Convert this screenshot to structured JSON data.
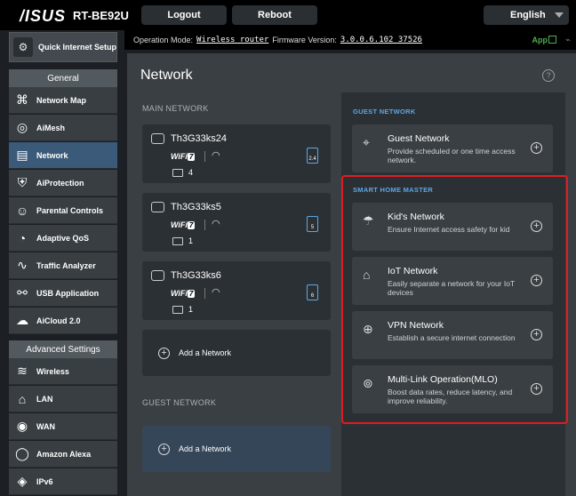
{
  "header": {
    "brand": "/ISUS",
    "model": "RT-BE92U",
    "logout_label": "Logout",
    "reboot_label": "Reboot",
    "language": "English"
  },
  "status": {
    "mode_label": "Operation Mode:",
    "mode_value": "Wireless router",
    "firmware_label": "Firmware Version:",
    "firmware_value": "3.0.0.6.102_37526",
    "app_label": "App"
  },
  "sidebar": {
    "quick_setup": "Quick Internet Setup",
    "general_header": "General",
    "general_items": [
      {
        "label": "Network Map",
        "icon": "network-map-icon"
      },
      {
        "label": "AiMesh",
        "icon": "aimesh-icon"
      },
      {
        "label": "Network",
        "icon": "network-icon"
      },
      {
        "label": "AiProtection",
        "icon": "aiprotection-icon"
      },
      {
        "label": "Parental Controls",
        "icon": "parental-icon"
      },
      {
        "label": "Adaptive QoS",
        "icon": "qos-icon"
      },
      {
        "label": "Traffic Analyzer",
        "icon": "traffic-icon"
      },
      {
        "label": "USB Application",
        "icon": "usb-icon"
      },
      {
        "label": "AiCloud 2.0",
        "icon": "cloud-icon"
      }
    ],
    "advanced_header": "Advanced Settings",
    "advanced_items": [
      {
        "label": "Wireless",
        "icon": "wireless-icon"
      },
      {
        "label": "LAN",
        "icon": "lan-icon"
      },
      {
        "label": "WAN",
        "icon": "wan-icon"
      },
      {
        "label": "Amazon Alexa",
        "icon": "alexa-icon"
      },
      {
        "label": "IPv6",
        "icon": "ipv6-icon"
      }
    ]
  },
  "page": {
    "title": "Network",
    "help": "?"
  },
  "main_network": {
    "header": "MAIN NETWORK",
    "wifi_text": "WiFi",
    "wifi_gen": "7",
    "networks": [
      {
        "name": "Th3G33ks24",
        "band": "2.4",
        "devices": "4"
      },
      {
        "name": "Th3G33ks5",
        "band": "5",
        "devices": "1"
      },
      {
        "name": "Th3G33ks6",
        "band": "6",
        "devices": "1"
      }
    ],
    "add_label": "Add a Network"
  },
  "guest_network_left": {
    "header": "GUEST NETWORK",
    "add_label": "Add a Network"
  },
  "right": {
    "guest_header": "GUEST NETWORK",
    "guest_card": {
      "title": "Guest Network",
      "desc": "Provide scheduled or one time access network."
    },
    "smart_header": "SMART HOME MASTER",
    "smart_cards": [
      {
        "title": "Kid's Network",
        "desc": "Ensure Internet access safety for kid",
        "icon": "kids-icon"
      },
      {
        "title": "IoT Network",
        "desc": "Easily separate a network for your IoT devices",
        "icon": "iot-house-icon"
      },
      {
        "title": "VPN Network",
        "desc": "Establish a secure internet connection",
        "icon": "vpn-globe-icon"
      },
      {
        "title": "Multi-Link Operation(MLO)",
        "desc": "Boost data rates, reduce latency, and improve reliability.",
        "icon": "mlo-icon"
      }
    ]
  }
}
